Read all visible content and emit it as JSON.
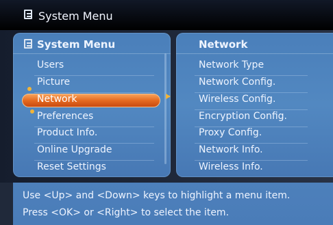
{
  "window": {
    "title": "System Menu"
  },
  "left_panel": {
    "title": "System Menu",
    "items": [
      {
        "label": "Users"
      },
      {
        "label": "Picture"
      },
      {
        "label": "Network"
      },
      {
        "label": "Preferences"
      },
      {
        "label": "Product Info."
      },
      {
        "label": "Online Upgrade"
      },
      {
        "label": "Reset Settings"
      }
    ],
    "selected": "Network"
  },
  "right_panel": {
    "title": "Network",
    "items": [
      {
        "label": "Network Type"
      },
      {
        "label": "Network Config."
      },
      {
        "label": "Wireless Config."
      },
      {
        "label": "Encryption Config."
      },
      {
        "label": "Proxy Config."
      },
      {
        "label": "Network Info."
      },
      {
        "label": "Wireless Info."
      }
    ]
  },
  "footer": {
    "line1": "Use <Up> and <Down> keys to highlight a menu item.",
    "line2": "Press <OK> or <Right> to select the item."
  },
  "colors": {
    "panel": "#4a7fba",
    "selection": "#e56a20",
    "marker": "#f1b438",
    "background": "#1a2233"
  },
  "icons": {
    "menu": "document-icon",
    "selection_up": "dot-icon",
    "selection_down": "dot-icon",
    "enter": "right-arrow-icon"
  }
}
